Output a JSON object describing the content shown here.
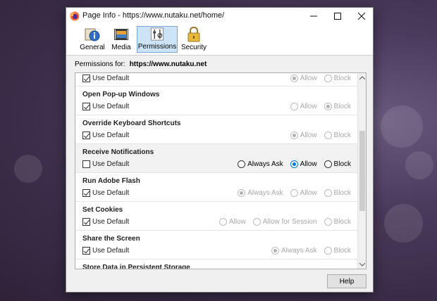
{
  "window": {
    "title": "Page Info - https://www.nutaku.net/home/"
  },
  "tabs": [
    {
      "label": "General",
      "icon": "info-icon"
    },
    {
      "label": "Media",
      "icon": "media-icon"
    },
    {
      "label": "Permissions",
      "icon": "permissions-icon",
      "active": true
    },
    {
      "label": "Security",
      "icon": "lock-icon"
    }
  ],
  "permissions_for": {
    "label": "Permissions for:",
    "site": "https://www.nutaku.net"
  },
  "permissions": [
    {
      "title": "",
      "use_default": true,
      "options": [
        {
          "label": "Allow",
          "selected": true,
          "disabled": true
        },
        {
          "label": "Block",
          "selected": false,
          "disabled": true
        }
      ]
    },
    {
      "title": "Open Pop-up Windows",
      "use_default": true,
      "options": [
        {
          "label": "Allow",
          "selected": false,
          "disabled": true
        },
        {
          "label": "Block",
          "selected": true,
          "disabled": true
        }
      ]
    },
    {
      "title": "Override Keyboard Shortcuts",
      "use_default": true,
      "options": [
        {
          "label": "Allow",
          "selected": true,
          "disabled": true
        },
        {
          "label": "Block",
          "selected": false,
          "disabled": true
        }
      ]
    },
    {
      "title": "Receive Notifications",
      "use_default": false,
      "highlight": true,
      "options": [
        {
          "label": "Always Ask",
          "selected": false,
          "disabled": false
        },
        {
          "label": "Allow",
          "selected": true,
          "disabled": false
        },
        {
          "label": "Block",
          "selected": false,
          "disabled": false
        }
      ]
    },
    {
      "title": "Run Adobe Flash",
      "use_default": true,
      "options": [
        {
          "label": "Always Ask",
          "selected": true,
          "disabled": true
        },
        {
          "label": "Allow",
          "selected": false,
          "disabled": true
        },
        {
          "label": "Block",
          "selected": false,
          "disabled": true
        }
      ]
    },
    {
      "title": "Set Cookies",
      "use_default": true,
      "options": [
        {
          "label": "Allow",
          "selected": false,
          "disabled": true
        },
        {
          "label": "Allow for Session",
          "selected": false,
          "disabled": true
        },
        {
          "label": "Block",
          "selected": false,
          "disabled": true
        }
      ]
    },
    {
      "title": "Share the Screen",
      "use_default": true,
      "options": [
        {
          "label": "Always Ask",
          "selected": true,
          "disabled": true
        },
        {
          "label": "Block",
          "selected": false,
          "disabled": true
        }
      ]
    },
    {
      "title": "Store Data in Persistent Storage",
      "use_default": true,
      "options": []
    }
  ],
  "use_default_label": "Use Default",
  "help_label": "Help",
  "colors": {
    "accent": "#0078d7",
    "active_tab": "#cde4f7"
  }
}
